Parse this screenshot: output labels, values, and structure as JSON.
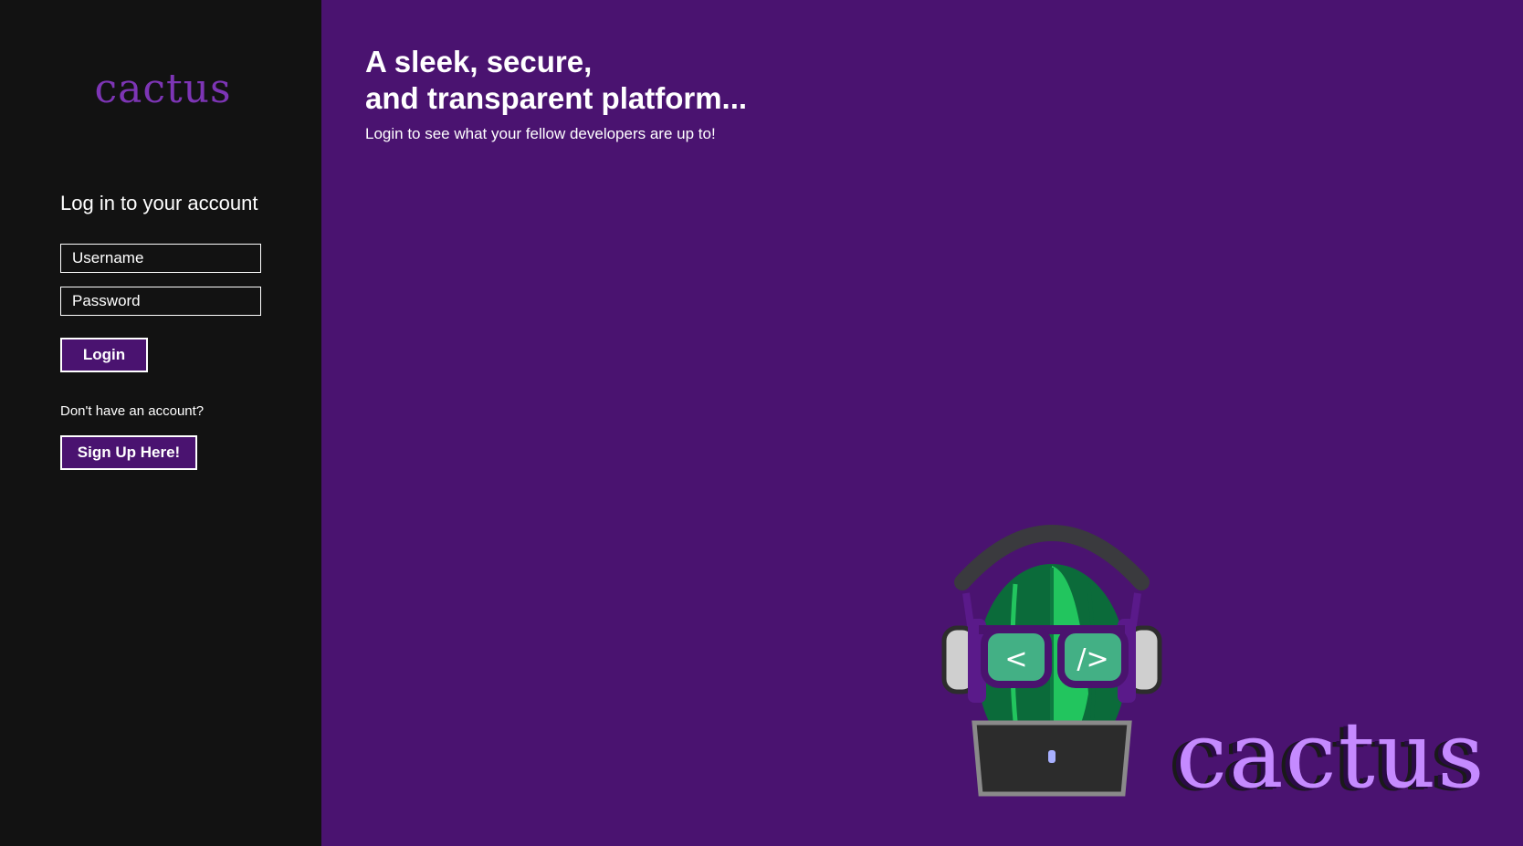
{
  "sidebar": {
    "brand": "cactus",
    "login_heading": "Log in to your account",
    "username_placeholder": "Username",
    "password_placeholder": "Password",
    "login_label": "Login",
    "no_account_text": "Don't have an account?",
    "signup_label": "Sign Up Here!"
  },
  "hero": {
    "title_line1": "A sleek, secure,",
    "title_line2": "and transparent platform...",
    "subtitle": "Login to see what your fellow developers are up to!"
  },
  "mascot": {
    "icon": "cactus-mascot-icon",
    "left_lens_glyph": "<",
    "right_lens_glyph": "/>",
    "brand": "cactus"
  },
  "colors": {
    "sidebar_bg": "#121212",
    "main_bg": "#4a1370",
    "brand_purple": "#7d35b5",
    "wordmark_purple": "#c58aff",
    "cactus_green": "#22c55e"
  }
}
